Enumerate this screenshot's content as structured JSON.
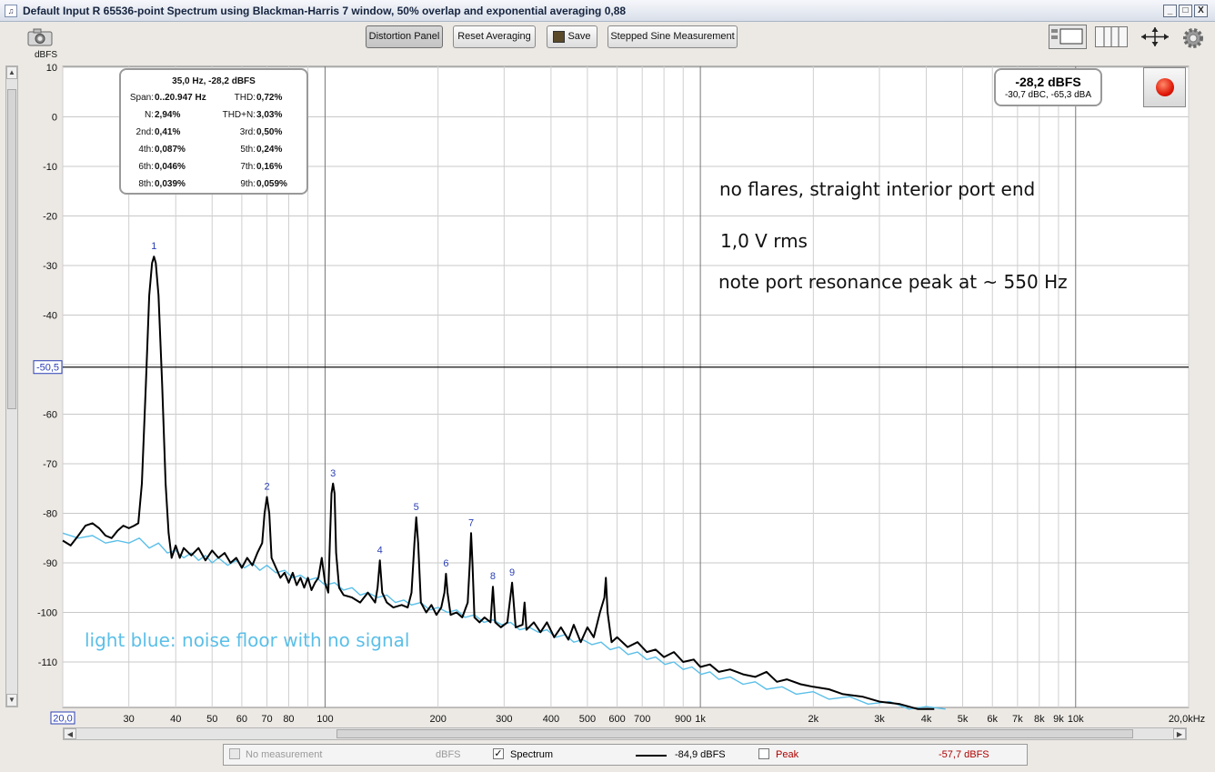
{
  "window": {
    "title": "Default Input R 65536-point Spectrum using Blackman-Harris 7 window, 50% overlap and exponential averaging 0,88",
    "minimize": "_",
    "maximize": "□",
    "close": "X"
  },
  "toolbar": {
    "distortion_panel": "Distortion Panel",
    "reset_averaging": "Reset Averaging",
    "save": "Save",
    "stepped_sine": "Stepped Sine Measurement"
  },
  "info": {
    "header": "35,0 Hz, -28,2 dBFS",
    "rows": [
      {
        "l1": "Span:",
        "v1": "0..20.947 Hz",
        "l2": "THD:",
        "v2": "0,72%"
      },
      {
        "l1": "N:",
        "v1": "2,94%",
        "l2": "THD+N:",
        "v2": "3,03%"
      },
      {
        "l1": "2nd:",
        "v1": "0,41%",
        "l2": "3rd:",
        "v2": "0,50%"
      },
      {
        "l1": "4th:",
        "v1": "0,087%",
        "l2": "5th:",
        "v2": "0,24%"
      },
      {
        "l1": "6th:",
        "v1": "0,046%",
        "l2": "7th:",
        "v2": "0,16%"
      },
      {
        "l1": "8th:",
        "v1": "0,039%",
        "l2": "9th:",
        "v2": "0,059%"
      }
    ]
  },
  "level": {
    "main": "-28,2 dBFS",
    "sub": "-30,7 dBC, -65,3 dBA"
  },
  "annotations": {
    "line1": "no flares, straight interior port end",
    "line2": "1,0 V rms",
    "line3": "note port resonance peak at ~ 550 Hz",
    "noise": "light blue: noise floor with no signal"
  },
  "chart_data": {
    "type": "line",
    "ylabel": "dBFS",
    "xlabel": "",
    "x_scale": "log",
    "xlim": [
      20,
      20000
    ],
    "ylim": [
      -120,
      10
    ],
    "y_ticks": [
      10,
      0,
      -10,
      -20,
      -30,
      -40,
      -60,
      -70,
      -80,
      -90,
      -100,
      -110
    ],
    "x_tick_labels": [
      {
        "f": 20,
        "t": "20,0"
      },
      {
        "f": 30,
        "t": "30"
      },
      {
        "f": 40,
        "t": "40"
      },
      {
        "f": 50,
        "t": "50"
      },
      {
        "f": 60,
        "t": "60"
      },
      {
        "f": 70,
        "t": "70"
      },
      {
        "f": 80,
        "t": "80"
      },
      {
        "f": 100,
        "t": "100"
      },
      {
        "f": 200,
        "t": "200"
      },
      {
        "f": 300,
        "t": "300"
      },
      {
        "f": 400,
        "t": "400"
      },
      {
        "f": 500,
        "t": "500"
      },
      {
        "f": 600,
        "t": "600"
      },
      {
        "f": 700,
        "t": "700"
      },
      {
        "f": 900,
        "t": "900"
      },
      {
        "f": 1000,
        "t": "1k"
      },
      {
        "f": 2000,
        "t": "2k"
      },
      {
        "f": 3000,
        "t": "3k"
      },
      {
        "f": 4000,
        "t": "4k"
      },
      {
        "f": 5000,
        "t": "5k"
      },
      {
        "f": 6000,
        "t": "6k"
      },
      {
        "f": 7000,
        "t": "7k"
      },
      {
        "f": 8000,
        "t": "8k"
      },
      {
        "f": 9000,
        "t": "9k"
      },
      {
        "f": 10000,
        "t": "10k"
      },
      {
        "f": 20000,
        "t": "20,0kHz"
      }
    ],
    "cursor_db": -50.5,
    "cursor_label": "-50,5",
    "vertical_markers_hz": [
      100,
      1000,
      10000
    ],
    "harmonic_labels": [
      {
        "n": "1",
        "f": 35,
        "db": -28.2
      },
      {
        "n": "2",
        "f": 70,
        "db": -76.7
      },
      {
        "n": "3",
        "f": 105,
        "db": -74.0
      },
      {
        "n": "4",
        "f": 140,
        "db": -89.5
      },
      {
        "n": "5",
        "f": 175,
        "db": -80.8
      },
      {
        "n": "6",
        "f": 210,
        "db": -92.2
      },
      {
        "n": "7",
        "f": 245,
        "db": -84.0
      },
      {
        "n": "8",
        "f": 280,
        "db": -94.8
      },
      {
        "n": "9",
        "f": 315,
        "db": -94.0
      }
    ],
    "series": [
      {
        "color": "#000000",
        "points": [
          [
            20,
            -85.5
          ],
          [
            21,
            -86.5
          ],
          [
            22,
            -84.5
          ],
          [
            23,
            -82.5
          ],
          [
            24,
            -82
          ],
          [
            25,
            -83
          ],
          [
            26,
            -84.5
          ],
          [
            27,
            -85
          ],
          [
            28,
            -83.5
          ],
          [
            29,
            -82.5
          ],
          [
            30,
            -83
          ],
          [
            31,
            -82.5
          ],
          [
            31.8,
            -82
          ],
          [
            32.5,
            -74
          ],
          [
            33.3,
            -54
          ],
          [
            34,
            -36
          ],
          [
            34.6,
            -29.5
          ],
          [
            35,
            -28.2
          ],
          [
            35.4,
            -29.5
          ],
          [
            36,
            -36
          ],
          [
            36.8,
            -54
          ],
          [
            37.6,
            -74
          ],
          [
            38.3,
            -84
          ],
          [
            39,
            -89
          ],
          [
            40,
            -86.5
          ],
          [
            41,
            -89
          ],
          [
            42,
            -87
          ],
          [
            44,
            -88.5
          ],
          [
            46,
            -87
          ],
          [
            48,
            -89.5
          ],
          [
            50,
            -87.5
          ],
          [
            52,
            -89
          ],
          [
            54,
            -88
          ],
          [
            56,
            -90
          ],
          [
            58,
            -89
          ],
          [
            60,
            -91
          ],
          [
            62,
            -89
          ],
          [
            64,
            -90.5
          ],
          [
            66,
            -88
          ],
          [
            68,
            -86
          ],
          [
            69,
            -80
          ],
          [
            70,
            -76.7
          ],
          [
            71,
            -80
          ],
          [
            72,
            -89
          ],
          [
            74,
            -91
          ],
          [
            76,
            -93
          ],
          [
            78,
            -92
          ],
          [
            80,
            -94
          ],
          [
            82,
            -92
          ],
          [
            84,
            -94.5
          ],
          [
            86,
            -93
          ],
          [
            88,
            -95
          ],
          [
            90,
            -93
          ],
          [
            92,
            -95.5
          ],
          [
            94,
            -94
          ],
          [
            96,
            -93
          ],
          [
            98,
            -89
          ],
          [
            100,
            -94
          ],
          [
            102,
            -96
          ],
          [
            103,
            -86
          ],
          [
            104,
            -76
          ],
          [
            105,
            -74
          ],
          [
            106,
            -76
          ],
          [
            107,
            -88
          ],
          [
            109,
            -95
          ],
          [
            112,
            -96.5
          ],
          [
            118,
            -97
          ],
          [
            124,
            -98
          ],
          [
            130,
            -96
          ],
          [
            136,
            -98
          ],
          [
            138,
            -95
          ],
          [
            140,
            -89.5
          ],
          [
            142,
            -96
          ],
          [
            146,
            -98
          ],
          [
            152,
            -99
          ],
          [
            160,
            -98.5
          ],
          [
            166,
            -99
          ],
          [
            170,
            -96
          ],
          [
            173,
            -86
          ],
          [
            175,
            -80.8
          ],
          [
            177,
            -86
          ],
          [
            180,
            -98
          ],
          [
            186,
            -100
          ],
          [
            192,
            -98.5
          ],
          [
            198,
            -100.5
          ],
          [
            204,
            -99
          ],
          [
            208,
            -96
          ],
          [
            210,
            -92.2
          ],
          [
            212,
            -96
          ],
          [
            216,
            -100.5
          ],
          [
            224,
            -100
          ],
          [
            232,
            -101
          ],
          [
            240,
            -98
          ],
          [
            243,
            -90
          ],
          [
            245,
            -84
          ],
          [
            247,
            -90
          ],
          [
            250,
            -101
          ],
          [
            258,
            -102
          ],
          [
            266,
            -101
          ],
          [
            276,
            -102
          ],
          [
            280,
            -94.8
          ],
          [
            284,
            -102
          ],
          [
            294,
            -103
          ],
          [
            306,
            -102
          ],
          [
            315,
            -94
          ],
          [
            322,
            -103
          ],
          [
            336,
            -102.5
          ],
          [
            340,
            -98
          ],
          [
            344,
            -103.5
          ],
          [
            360,
            -102
          ],
          [
            375,
            -104
          ],
          [
            390,
            -102
          ],
          [
            408,
            -105
          ],
          [
            425,
            -103
          ],
          [
            445,
            -105.5
          ],
          [
            460,
            -102.5
          ],
          [
            480,
            -106
          ],
          [
            500,
            -103
          ],
          [
            520,
            -105
          ],
          [
            540,
            -100
          ],
          [
            555,
            -97
          ],
          [
            560,
            -93
          ],
          [
            566,
            -100
          ],
          [
            580,
            -106
          ],
          [
            600,
            -105
          ],
          [
            640,
            -107
          ],
          [
            680,
            -106
          ],
          [
            720,
            -108
          ],
          [
            760,
            -107.5
          ],
          [
            800,
            -109
          ],
          [
            850,
            -108
          ],
          [
            900,
            -110
          ],
          [
            960,
            -109.5
          ],
          [
            1000,
            -111
          ],
          [
            1060,
            -110.5
          ],
          [
            1120,
            -112
          ],
          [
            1200,
            -111.5
          ],
          [
            1300,
            -112.5
          ],
          [
            1400,
            -113
          ],
          [
            1500,
            -112
          ],
          [
            1600,
            -114
          ],
          [
            1700,
            -113.5
          ],
          [
            1850,
            -114.5
          ],
          [
            2000,
            -115
          ],
          [
            2200,
            -115.5
          ],
          [
            2400,
            -116.5
          ],
          [
            2700,
            -117
          ],
          [
            3000,
            -118
          ],
          [
            3400,
            -118.5
          ],
          [
            3800,
            -119.5
          ],
          [
            4200,
            -120
          ]
        ]
      },
      {
        "color": "#5bbfe8",
        "points": [
          [
            20,
            -84
          ],
          [
            22,
            -85
          ],
          [
            24,
            -84.5
          ],
          [
            26,
            -86
          ],
          [
            28,
            -85.5
          ],
          [
            30,
            -86
          ],
          [
            32,
            -85
          ],
          [
            34,
            -87
          ],
          [
            36,
            -86
          ],
          [
            38,
            -88
          ],
          [
            40,
            -87.5
          ],
          [
            42,
            -89
          ],
          [
            44,
            -88
          ],
          [
            46,
            -89.5
          ],
          [
            48,
            -88.5
          ],
          [
            50,
            -90
          ],
          [
            52,
            -89
          ],
          [
            55,
            -90.5
          ],
          [
            58,
            -89.5
          ],
          [
            61,
            -91
          ],
          [
            64,
            -90
          ],
          [
            67,
            -91.5
          ],
          [
            70,
            -90.5
          ],
          [
            74,
            -92
          ],
          [
            78,
            -91.5
          ],
          [
            82,
            -93
          ],
          [
            86,
            -92.5
          ],
          [
            90,
            -93.5
          ],
          [
            95,
            -93
          ],
          [
            100,
            -94.5
          ],
          [
            106,
            -94
          ],
          [
            112,
            -95.5
          ],
          [
            118,
            -95
          ],
          [
            124,
            -96.5
          ],
          [
            130,
            -96
          ],
          [
            138,
            -97
          ],
          [
            146,
            -96.5
          ],
          [
            154,
            -98
          ],
          [
            162,
            -97.5
          ],
          [
            170,
            -98.5
          ],
          [
            180,
            -98
          ],
          [
            190,
            -99.5
          ],
          [
            200,
            -99
          ],
          [
            212,
            -100
          ],
          [
            224,
            -99.5
          ],
          [
            236,
            -101
          ],
          [
            250,
            -100.5
          ],
          [
            265,
            -102
          ],
          [
            280,
            -101.5
          ],
          [
            296,
            -102.5
          ],
          [
            312,
            -102
          ],
          [
            330,
            -103.5
          ],
          [
            350,
            -103
          ],
          [
            370,
            -104
          ],
          [
            390,
            -103.5
          ],
          [
            412,
            -105
          ],
          [
            436,
            -104.5
          ],
          [
            460,
            -106
          ],
          [
            486,
            -105.5
          ],
          [
            514,
            -106.5
          ],
          [
            544,
            -106
          ],
          [
            575,
            -107.5
          ],
          [
            608,
            -107
          ],
          [
            642,
            -108.5
          ],
          [
            680,
            -108
          ],
          [
            720,
            -109.5
          ],
          [
            760,
            -109
          ],
          [
            805,
            -110.5
          ],
          [
            850,
            -110
          ],
          [
            900,
            -111.5
          ],
          [
            950,
            -111
          ],
          [
            1005,
            -112.5
          ],
          [
            1060,
            -112
          ],
          [
            1120,
            -113.5
          ],
          [
            1200,
            -113
          ],
          [
            1300,
            -114.5
          ],
          [
            1400,
            -114
          ],
          [
            1500,
            -115.5
          ],
          [
            1650,
            -115
          ],
          [
            1800,
            -116.5
          ],
          [
            2000,
            -116
          ],
          [
            2200,
            -117.5
          ],
          [
            2500,
            -117
          ],
          [
            2800,
            -118.5
          ],
          [
            3200,
            -118
          ],
          [
            3600,
            -119.5
          ],
          [
            4000,
            -119
          ],
          [
            4500,
            -120
          ]
        ]
      }
    ]
  },
  "legend": {
    "no_measurement": "No measurement",
    "unit1": "dBFS",
    "spectrum": "Spectrum",
    "spectrum_check": "✓",
    "spectrum_value": "-84,9 dBFS",
    "peak": "Peak",
    "peak_value": "-57,7 dBFS"
  }
}
